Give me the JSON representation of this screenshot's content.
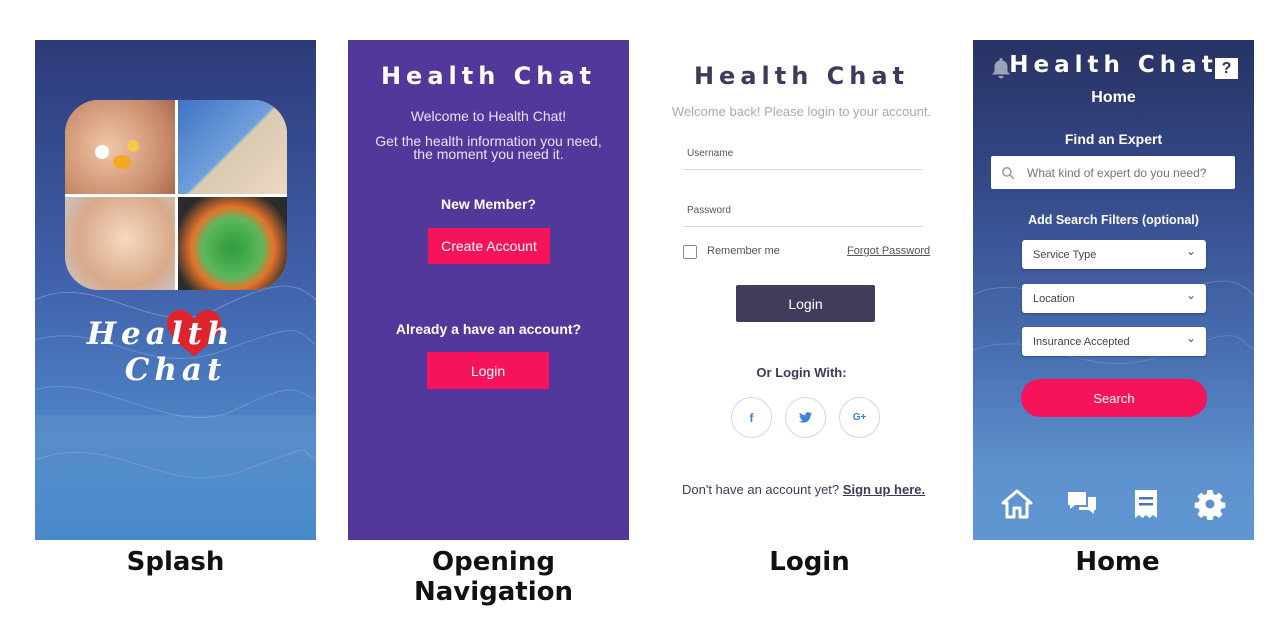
{
  "splash": {
    "logo_part1": "Health",
    "logo_part2": "Chat",
    "caption": "Splash"
  },
  "opening": {
    "title": "Health Chat",
    "welcome": "Welcome to Health Chat!",
    "tagline": "Get the health information you need, the moment you need it.",
    "new_member": "New Member?",
    "create_account": "Create Account",
    "have_account": "Already a have an account?",
    "login": "Login",
    "caption": "Opening Navigation"
  },
  "login": {
    "title": "Health Chat",
    "subtitle": "Welcome back! Please login to your account.",
    "username_label": "Username",
    "password_label": "Password",
    "remember_me": "Remember me",
    "forgot_password": "Forgot Password",
    "login_button": "Login",
    "or_login_with": "Or Login With:",
    "social": [
      "f",
      "t",
      "G+"
    ],
    "no_account": "Don't have an account yet?",
    "sign_up": "Sign up here.",
    "caption": "Login"
  },
  "home": {
    "title": "Health Chat",
    "page_title": "Home",
    "find_expert": "Find an Expert",
    "search_placeholder": "What kind of expert do you need?",
    "filters_label": "Add Search Filters (optional)",
    "filter_service": "Service Type",
    "filter_location": "Location",
    "filter_insurance": "Insurance Accepted",
    "search_button": "Search",
    "help": "?",
    "caption": "Home"
  },
  "colors": {
    "accent_pink": "#f5135a",
    "opening_purple": "#52389a",
    "login_dark": "#403d5c"
  }
}
